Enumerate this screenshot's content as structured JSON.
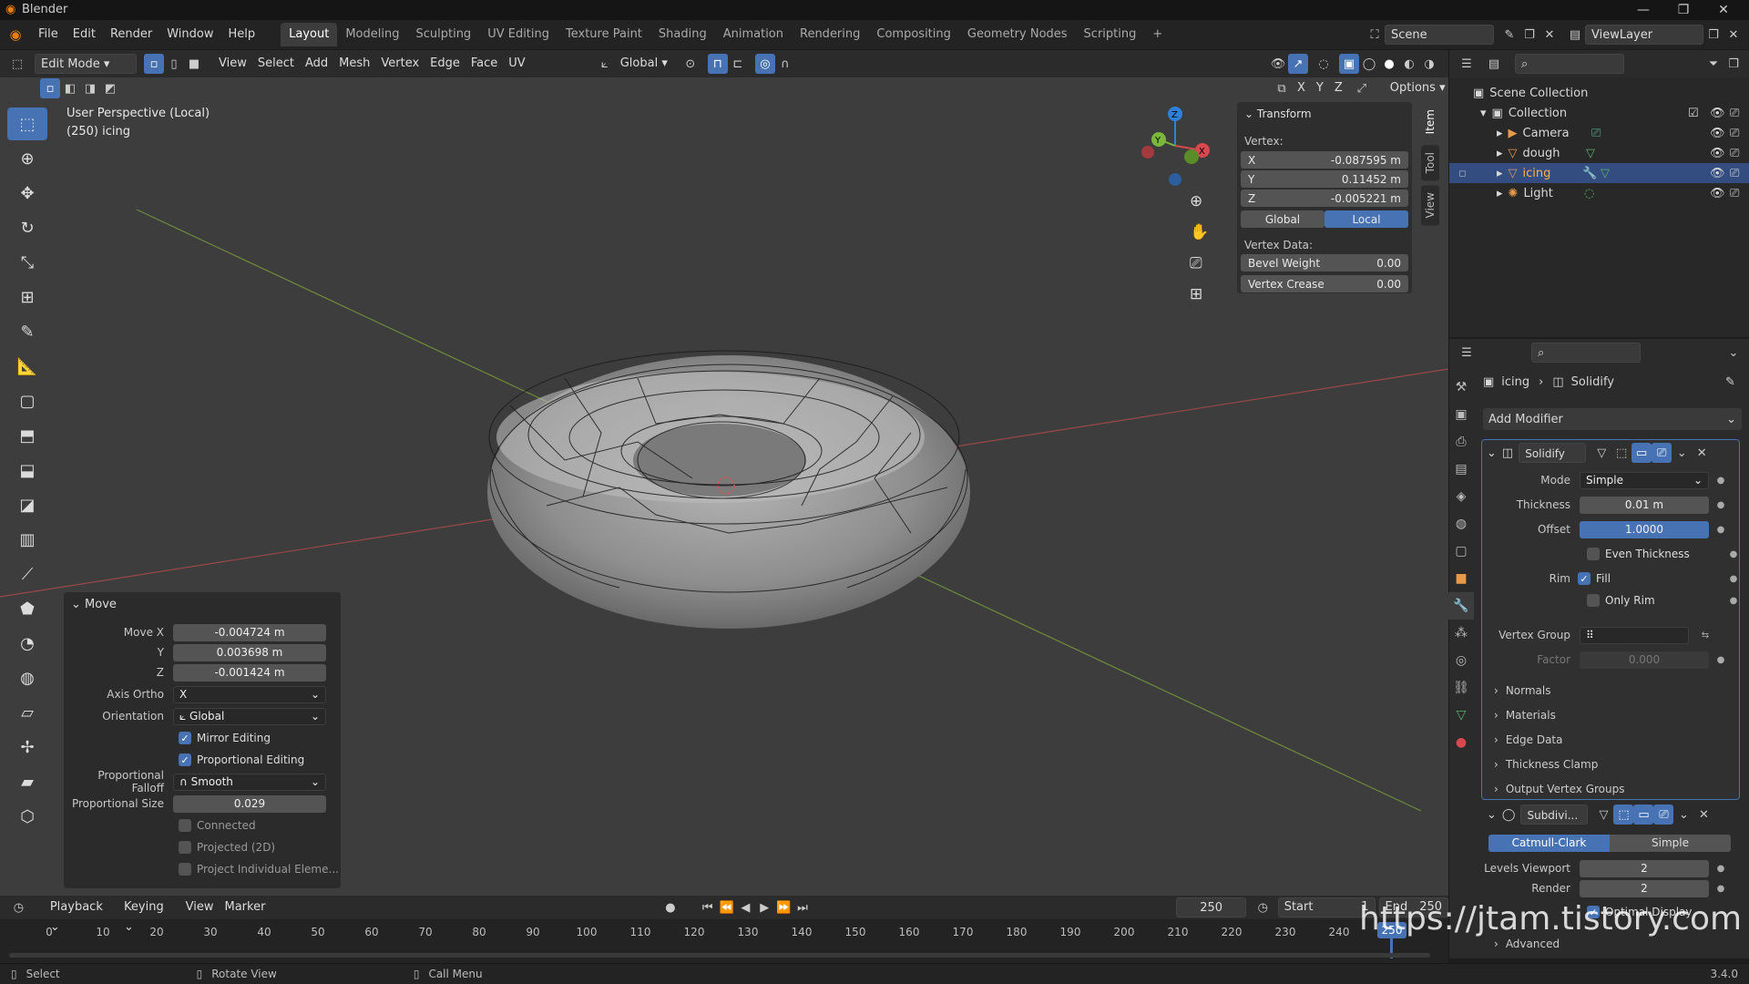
{
  "window": {
    "title": "Blender"
  },
  "menu": [
    "File",
    "Edit",
    "Render",
    "Window",
    "Help"
  ],
  "workspaces": [
    "Layout",
    "Modeling",
    "Sculpting",
    "UV Editing",
    "Texture Paint",
    "Shading",
    "Animation",
    "Rendering",
    "Compositing",
    "Geometry Nodes",
    "Scripting",
    "+"
  ],
  "active_workspace": "Layout",
  "scene": {
    "name": "Scene",
    "view_layer": "ViewLayer"
  },
  "viewport_header": {
    "mode": "Edit Mode",
    "menus": [
      "View",
      "Select",
      "Add",
      "Mesh",
      "Vertex",
      "Edge",
      "Face",
      "UV"
    ],
    "orientation": "Global",
    "options": "Options",
    "axes": [
      "X",
      "Y",
      "Z"
    ]
  },
  "viewport": {
    "perspective": "User Perspective (Local)",
    "object_label": "(250) icing"
  },
  "npanel": {
    "section": "Transform",
    "vertex_label": "Vertex:",
    "vertex": [
      {
        "axis": "X",
        "value": "-0.087595 m"
      },
      {
        "axis": "Y",
        "value": "0.11452 m"
      },
      {
        "axis": "Z",
        "value": "-0.005221 m"
      }
    ],
    "space": [
      "Global",
      "Local"
    ],
    "vertex_data_label": "Vertex Data:",
    "bevel_weight": {
      "label": "Bevel Weight",
      "value": "0.00"
    },
    "vertex_crease": {
      "label": "Vertex Crease",
      "value": "0.00"
    },
    "tabs": [
      "Item",
      "Tool",
      "View"
    ]
  },
  "move_panel": {
    "title": "Move",
    "move": [
      {
        "label": "Move X",
        "value": "-0.004724 m"
      },
      {
        "label": "Y",
        "value": "0.003698 m"
      },
      {
        "label": "Z",
        "value": "-0.001424 m"
      }
    ],
    "axis_ortho": {
      "label": "Axis Ortho",
      "value": "X"
    },
    "orientation": {
      "label": "Orientation",
      "value": "Global"
    },
    "mirror_editing": "Mirror Editing",
    "proportional_editing": "Proportional Editing",
    "falloff": {
      "label": "Proportional Falloff",
      "value": "Smooth"
    },
    "size": {
      "label": "Proportional Size",
      "value": "0.029"
    },
    "connected": "Connected",
    "projected": "Projected (2D)",
    "project_individual": "Project Individual Eleme..."
  },
  "outliner": {
    "root": "Scene Collection",
    "collection": "Collection",
    "items": [
      "Camera",
      "dough",
      "icing",
      "Light"
    ]
  },
  "properties": {
    "breadcrumb_object": "icing",
    "breadcrumb_modifier": "Solidify",
    "add_modifier": "Add Modifier",
    "solidify": {
      "name": "Solidify",
      "mode": {
        "label": "Mode",
        "value": "Simple"
      },
      "thickness": {
        "label": "Thickness",
        "value": "0.01 m"
      },
      "offset": {
        "label": "Offset",
        "value": "1.0000"
      },
      "even_thickness": "Even Thickness",
      "rim_label": "Rim",
      "fill": "Fill",
      "only_rim": "Only Rim",
      "vertex_group": "Vertex Group",
      "factor": {
        "label": "Factor",
        "value": "0.000"
      },
      "subpanels": [
        "Normals",
        "Materials",
        "Edge Data",
        "Thickness Clamp",
        "Output Vertex Groups"
      ]
    },
    "subdivision": {
      "name": "Subdivi...",
      "types": [
        "Catmull-Clark",
        "Simple"
      ],
      "levels_viewport": {
        "label": "Levels Viewport",
        "value": "2"
      },
      "render": {
        "label": "Render",
        "value": "2"
      },
      "optimal_display": "Optimal Display",
      "advanced": "Advanced"
    }
  },
  "timeline": {
    "menus": [
      "Playback",
      "Keying",
      "View",
      "Marker"
    ],
    "current_frame": "250",
    "start": {
      "label": "Start",
      "value": "1"
    },
    "end": {
      "label": "End",
      "value": "250"
    },
    "ticks": [
      "0",
      "10",
      "20",
      "30",
      "40",
      "50",
      "60",
      "70",
      "80",
      "90",
      "100",
      "110",
      "120",
      "130",
      "140",
      "150",
      "160",
      "170",
      "180",
      "190",
      "200",
      "210",
      "220",
      "230",
      "240"
    ],
    "playhead": "250"
  },
  "statusbar": {
    "select": "Select",
    "rotate": "Rotate View",
    "call_menu": "Call Menu",
    "version": "3.4.0"
  },
  "watermark": "https://jtam.tistory.com",
  "colors": {
    "accent": "#4772b3",
    "bg": "#3d3d3d",
    "panel": "#2b2b2b"
  }
}
